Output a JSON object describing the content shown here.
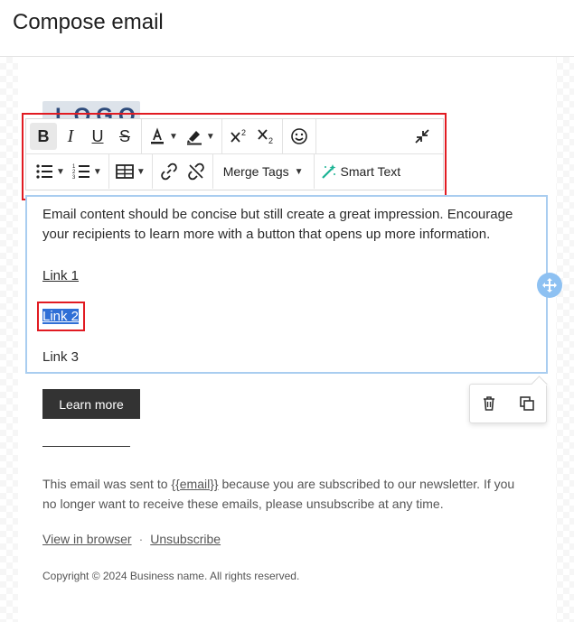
{
  "header": {
    "title": "Compose email"
  },
  "logo": {
    "text": "LOGO"
  },
  "toolbar": {
    "row1": {
      "bold": "B",
      "italic": "I",
      "underline": "U",
      "strikethrough": "S"
    },
    "row2": {
      "merge_tags_label": "Merge Tags",
      "smart_text_label": "Smart Text"
    }
  },
  "content": {
    "paragraph": "Email content should be concise but still create a great impression. Encourage your recipients to learn more with a button that opens up more information.",
    "link1": "Link 1",
    "link2": "Link 2",
    "link3": "Link 3"
  },
  "button": {
    "label": "Learn more"
  },
  "footer": {
    "text_before": "This email was sent to ",
    "email_var": "{{email}}",
    "text_after": " because you are subscribed to our newsletter. If you no longer want to receive these emails, please unsubscribe at any time.",
    "view_in_browser": "View in browser",
    "separator": "·",
    "unsubscribe": "Unsubscribe",
    "copyright": "Copyright © 2024 Business name. All rights reserved."
  },
  "colors": {
    "selection": "#2f6fd6",
    "highlight_border": "#e11b22",
    "block_border": "#a9cdf0",
    "smart_text_icon": "#1bb394"
  }
}
